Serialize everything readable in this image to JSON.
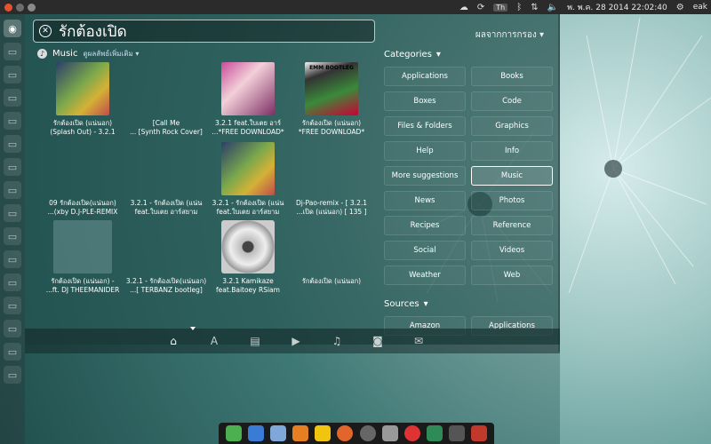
{
  "top_panel": {
    "datetime": "พ. พ.ค. 28 2014 22:02:40",
    "keyboard": "Th",
    "user": "eak"
  },
  "search": {
    "query": "รักต้องเปิด",
    "filter_toggle": "ผลจากการกรอง"
  },
  "music_category": {
    "title": "Music",
    "subtitle": "ดูผลลัพธ์เพิ่มเติม"
  },
  "results": [
    {
      "line1": "รักต้องเปิด (แน่นอก)",
      "line2": "(Splash Out) - 3.2.1"
    },
    {
      "line1": "[Call Me",
      "line2": "... [Synth Rock Cover]"
    },
    {
      "line1": "3.2.1 feat.ใบเตย อาร์",
      "line2": "...*FREE DOWNLOAD*"
    },
    {
      "line1": "รักต้องเปิด (แน่นอก)",
      "line2": "*FREE DOWNLOAD*"
    },
    {
      "line1": "09 รักต้องเปิด(แน่นอก)",
      "line2": "...(xby D.J-PLE-REMIX"
    },
    {
      "line1": "3.2.1 - รักต้องเปิด (แน่น",
      "line2": "feat.ใบเตย อาร์สยาม"
    },
    {
      "line1": "3.2.1 - รักต้องเปิด (แน่น",
      "line2": "feat.ใบเตย อาร์สยาม"
    },
    {
      "line1": "Dj-Pao-remix - [ 3.2.1",
      "line2": "...เปิด (แน่นอก) [ 135 ]"
    },
    {
      "line1": "รักต้องเปิด (แน่นอก) -",
      "line2": "...ft. DJ THEEMANIDER"
    },
    {
      "line1": "3.2.1 - รักต้องเปิด(แน่นอก)",
      "line2": "...[ TERBANZ bootleg]"
    },
    {
      "line1": "3.2.1 Kamikaze",
      "line2": "feat.Baitoey RSiam"
    },
    {
      "line1": "รักต้องเปิด (แน่นอก)",
      "line2": ""
    }
  ],
  "thumb_badge": "EMM BOOTLEG",
  "filters": {
    "categories_title": "Categories",
    "categories": [
      "Applications",
      "Books",
      "Boxes",
      "Code",
      "Files & Folders",
      "Graphics",
      "Help",
      "Info",
      "More suggestions",
      "Music",
      "News",
      "Photos",
      "Recipes",
      "Reference",
      "Social",
      "Videos",
      "Weather",
      "Web"
    ],
    "active": "Music",
    "sources_title": "Sources",
    "sources": [
      "Amazon",
      "Applications"
    ]
  },
  "lenses": [
    "home-icon",
    "apps-icon",
    "files-icon",
    "video-icon",
    "music-icon",
    "photo-icon",
    "social-icon"
  ],
  "colors": {
    "dash_bg": "#235a58",
    "accent": "#ffffff"
  }
}
